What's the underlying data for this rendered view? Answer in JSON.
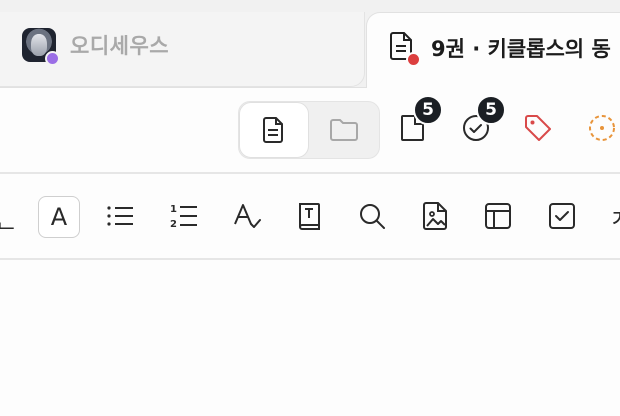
{
  "tabs": [
    {
      "title": "오디세우스",
      "active": false,
      "icon": "avatar-image",
      "status_color": "#9b6ee6"
    },
    {
      "title": "9권 · 키클롭스의 동",
      "active": true,
      "icon": "document-icon",
      "status_color": "#dc3f3f"
    }
  ],
  "toolbar": {
    "view_toggle": {
      "options": [
        "document-view",
        "folder-view"
      ],
      "selected": "document-view"
    },
    "pages_badge": "5",
    "tasks_badge": "5",
    "tag_color": "#d94a4a",
    "status_color": "#e8943a"
  },
  "format_toolbar": {
    "partial_left": "ᆫ",
    "font_button": "A",
    "partial_right": "ㅈ",
    "text_style_glyph": "A",
    "dictionary_glyph": "T"
  }
}
